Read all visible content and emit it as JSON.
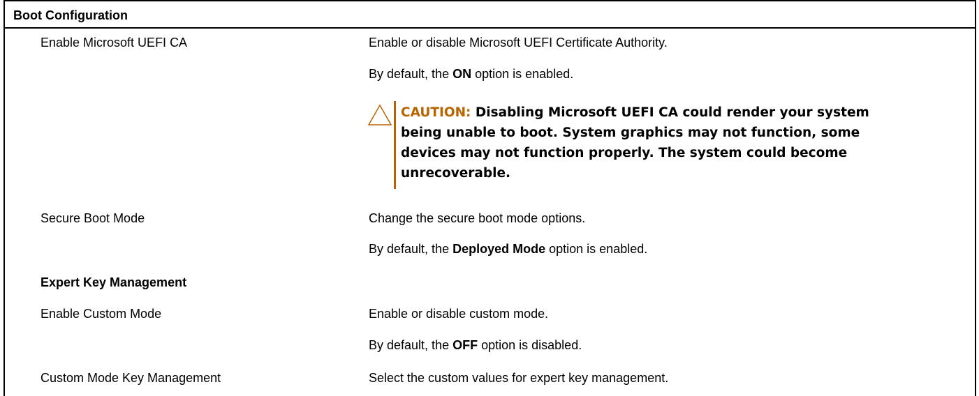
{
  "section": {
    "title": "Boot Configuration"
  },
  "rows": {
    "uefi_ca": {
      "label": "Enable Microsoft UEFI CA",
      "desc": "Enable or disable Microsoft UEFI Certificate Authority.",
      "default_pre": "By default, the",
      "default_value": "ON",
      "default_post": "option is enabled.",
      "caution": {
        "keyword": "CAUTION:",
        "lines": [
          "Disabling Microsoft UEFI CA could render your system",
          "being unable to boot. System graphics may not function, some",
          "devices may not function properly. The system could become",
          "unrecoverable."
        ]
      }
    },
    "secure_boot": {
      "label": "Secure Boot Mode",
      "desc": "Change the secure boot mode options.",
      "default_pre": "By default, the",
      "default_value": "Deployed Mode",
      "default_post": "option is enabled."
    },
    "expert": {
      "heading": "Expert Key Management"
    },
    "custom_mode": {
      "label": "Enable Custom Mode",
      "desc": "Enable or disable custom mode.",
      "default_pre": "By default, the",
      "default_value": "OFF",
      "default_post": "option is disabled."
    },
    "custom_key": {
      "label": "Custom Mode Key Management",
      "desc": "Select the custom values for expert key management."
    }
  },
  "colors": {
    "caution_accent": "#b86500",
    "border": "#000000"
  },
  "icons": {
    "caution": "warning-triangle-icon"
  }
}
